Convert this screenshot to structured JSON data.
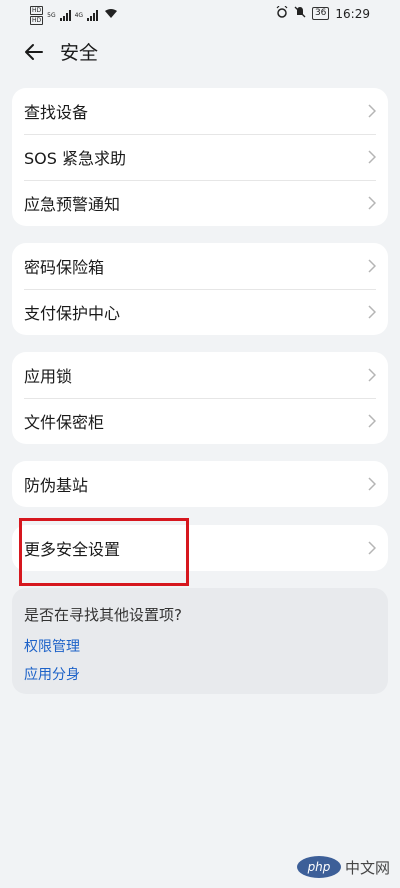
{
  "status_bar": {
    "sim1": "HD",
    "sim2": "HD",
    "net1": "5G",
    "net2": "4G",
    "battery": "36",
    "time": "16:29"
  },
  "header": {
    "title": "安全"
  },
  "cards": [
    {
      "items": [
        "查找设备",
        "SOS 紧急求助",
        "应急预警通知"
      ]
    },
    {
      "items": [
        "密码保险箱",
        "支付保护中心"
      ]
    },
    {
      "items": [
        "应用锁",
        "文件保密柜"
      ]
    },
    {
      "items": [
        "防伪基站"
      ]
    },
    {
      "items": [
        "更多安全设置"
      ]
    }
  ],
  "suggest": {
    "question": "是否在寻找其他设置项?",
    "links": [
      "权限管理",
      "应用分身"
    ]
  },
  "watermark": {
    "logo": "php",
    "site": "中文网"
  },
  "colors": {
    "background": "#f1f3f5",
    "card": "#ffffff",
    "link": "#1d62c8",
    "highlight": "#d6171e"
  }
}
